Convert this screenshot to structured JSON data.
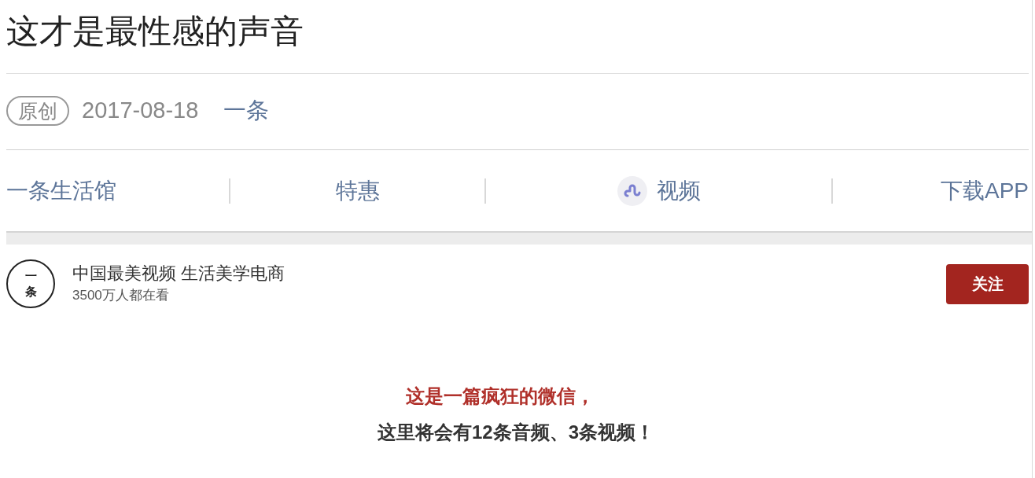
{
  "article": {
    "title": "这才是最性感的声音",
    "tag": "原创",
    "date": "2017-08-18",
    "author": "一条"
  },
  "nav": [
    {
      "label": "一条生活馆",
      "has_icon": false
    },
    {
      "label": "特惠",
      "has_icon": false
    },
    {
      "label": "视频",
      "has_icon": true
    },
    {
      "label": "下载APP",
      "has_icon": false
    }
  ],
  "account": {
    "logo": [
      "一",
      "条"
    ],
    "name": "中国最美视频 生活美学电商",
    "followers": "3500万人都在看",
    "follow_button": "关注"
  },
  "body": [
    {
      "text": "这是一篇疯狂的微信，",
      "kind": "highlight"
    },
    {
      "text": "这里将会有12条音频、3条视频！",
      "kind": "plain"
    }
  ]
}
